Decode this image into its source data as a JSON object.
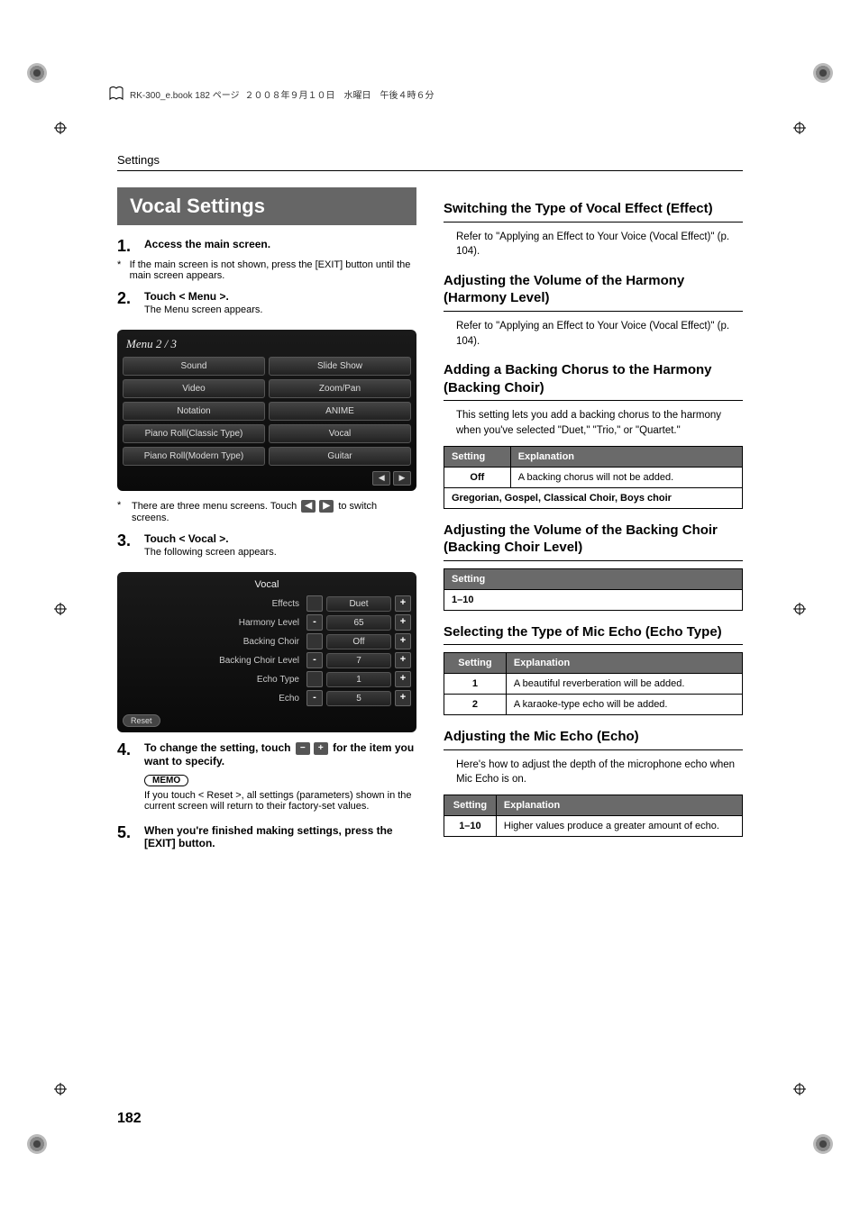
{
  "header_note_prefix": "RK-300_e.book  182 ページ",
  "header_note_date": "２００８年９月１０日　水曜日　午後４時６分",
  "running_head": "Settings",
  "left": {
    "title": "Vocal Settings",
    "step1_head": "Access the main screen.",
    "step1_note": "If the main screen is not shown, press the [EXIT] button until the main screen appears.",
    "step2_head": "Touch < Menu >.",
    "step2_sub": "The Menu screen appears.",
    "menu_title": "Menu 2 / 3",
    "menu_items": [
      "Sound",
      "Slide Show",
      "Video",
      "Zoom/Pan",
      "Notation",
      "ANIME",
      "Piano Roll(Classic Type)",
      "Vocal",
      "Piano Roll(Modern Type)",
      "Guitar"
    ],
    "step2_note_a": "There are three menu screens. Touch",
    "step2_note_b": "to switch screens.",
    "step3_head": "Touch < Vocal >.",
    "step3_sub": "The following screen appears.",
    "vocal_title": "Vocal",
    "vocal_rows": [
      {
        "label": "Effects",
        "minus": "",
        "value": "Duet",
        "plus": "+"
      },
      {
        "label": "Harmony Level",
        "minus": "-",
        "value": "65",
        "plus": "+"
      },
      {
        "label": "Backing Choir",
        "minus": "",
        "value": "Off",
        "plus": "+"
      },
      {
        "label": "Backing Choir Level",
        "minus": "-",
        "value": "7",
        "plus": "+"
      },
      {
        "label": "Echo Type",
        "minus": "",
        "value": "1",
        "plus": "+"
      },
      {
        "label": "Echo",
        "minus": "-",
        "value": "5",
        "plus": "+"
      }
    ],
    "reset_label": "Reset",
    "step4_head_a": "To change the setting, touch",
    "step4_head_b": "for the item you want to specify.",
    "memo_label": "MEMO",
    "memo_text": "If you touch < Reset >, all settings (parameters) shown in the current screen will return to their factory-set values.",
    "step5_head": "When you're finished making settings, press the [EXIT] button."
  },
  "right": {
    "s1_title": "Switching the Type of Vocal Effect (Effect)",
    "s1_text": "Refer to \"Applying an Effect to Your Voice (Vocal Effect)\" (p. 104).",
    "s2_title": "Adjusting the Volume of the Harmony (Harmony Level)",
    "s2_text": "Refer to \"Applying an Effect to Your Voice (Vocal Effect)\" (p. 104).",
    "s3_title": "Adding a Backing Chorus to the Harmony (Backing Choir)",
    "s3_text": "This setting lets you add a backing chorus to the harmony when you've selected \"Duet,\" \"Trio,\" or \"Quartet.\"",
    "s3_table": {
      "headers": [
        "Setting",
        "Explanation"
      ],
      "rows": [
        [
          "Off",
          "A backing chorus will not be added."
        ]
      ],
      "span_row": "Gregorian, Gospel, Classical Choir, Boys choir"
    },
    "s4_title": "Adjusting the Volume of the Backing Choir (Backing Choir Level)",
    "s4_table": {
      "headers": [
        "Setting"
      ],
      "rows": [
        [
          "1–10"
        ]
      ]
    },
    "s5_title": "Selecting the Type of Mic Echo (Echo Type)",
    "s5_table": {
      "headers": [
        "Setting",
        "Explanation"
      ],
      "rows": [
        [
          "1",
          "A beautiful reverberation will be added."
        ],
        [
          "2",
          "A karaoke-type echo will be added."
        ]
      ]
    },
    "s6_title": "Adjusting the Mic Echo (Echo)",
    "s6_text": "Here's how to adjust the depth of the microphone echo when Mic Echo is on.",
    "s6_table": {
      "headers": [
        "Setting",
        "Explanation"
      ],
      "rows": [
        [
          "1–10",
          "Higher values produce a greater amount of echo."
        ]
      ]
    }
  },
  "icons": {
    "minus": "−",
    "plus": "+",
    "left": "◀",
    "right": "▶"
  },
  "page_number": "182"
}
